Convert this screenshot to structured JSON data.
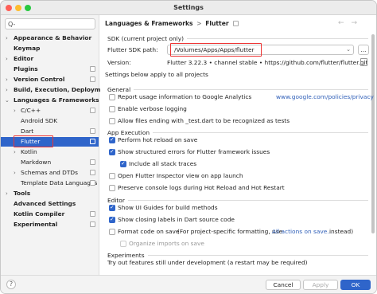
{
  "window": {
    "title": "Settings"
  },
  "search": {
    "placeholder": "Q-"
  },
  "sidebar": {
    "items": [
      {
        "label": "Appearance & Behavior"
      },
      {
        "label": "Keymap"
      },
      {
        "label": "Editor"
      },
      {
        "label": "Plugins"
      },
      {
        "label": "Version Control"
      },
      {
        "label": "Build, Execution, Deployment"
      },
      {
        "label": "Languages & Frameworks"
      },
      {
        "label": "C/C++"
      },
      {
        "label": "Android SDK"
      },
      {
        "label": "Dart"
      },
      {
        "label": "Flutter"
      },
      {
        "label": "Kotlin"
      },
      {
        "label": "Markdown"
      },
      {
        "label": "Schemas and DTDs"
      },
      {
        "label": "Template Data Languages"
      },
      {
        "label": "Tools"
      },
      {
        "label": "Advanced Settings"
      },
      {
        "label": "Kotlin Compiler"
      },
      {
        "label": "Experimental"
      }
    ]
  },
  "breadcrumb": {
    "parent": "Languages & Frameworks",
    "sep": ">",
    "current": "Flutter"
  },
  "sdk": {
    "heading": "SDK (current project only)",
    "path_label": "Flutter SDK path:",
    "path_value": "/Volumes/Apps/Apps/flutter",
    "browse": "...",
    "version_label": "Version:",
    "version_value": "Flutter 3.22.3 • channel stable • https://github.com/flutter/flutter.git"
  },
  "all_projects": {
    "heading": "Settings below apply to all projects"
  },
  "general": {
    "title": "General",
    "analytics": "Report usage information to Google Analytics",
    "privacy_link": "www.google.com/policies/privacy",
    "verbose": "Enable verbose logging",
    "test_files": "Allow files ending with _test.dart to be recognized as tests"
  },
  "app_execution": {
    "title": "App Execution",
    "hot_reload": "Perform hot reload on save",
    "structured_errors": "Show structured errors for Flutter framework issues",
    "stack_traces": "Include all stack traces",
    "inspector": "Open Flutter Inspector view on app launch",
    "preserve_logs": "Preserve console logs during Hot Reload and Hot Restart"
  },
  "editor": {
    "title": "Editor",
    "ui_guides": "Show UI Guides for build methods",
    "closing_labels": "Show closing labels in Dart source code",
    "format_code": "Format code on save",
    "format_note": "(For project-specific formatting, use",
    "all_actions_link": "All actions on save...",
    "format_note_end": "instead)",
    "organize_imports": "Organize imports on save"
  },
  "experiments": {
    "title": "Experiments",
    "note": "Try out features still under development (a restart may be required)"
  },
  "footer": {
    "help": "?",
    "cancel": "Cancel",
    "apply": "Apply",
    "ok": "OK"
  },
  "colors": {
    "accent": "#2f65ca",
    "highlight": "#e33333"
  }
}
